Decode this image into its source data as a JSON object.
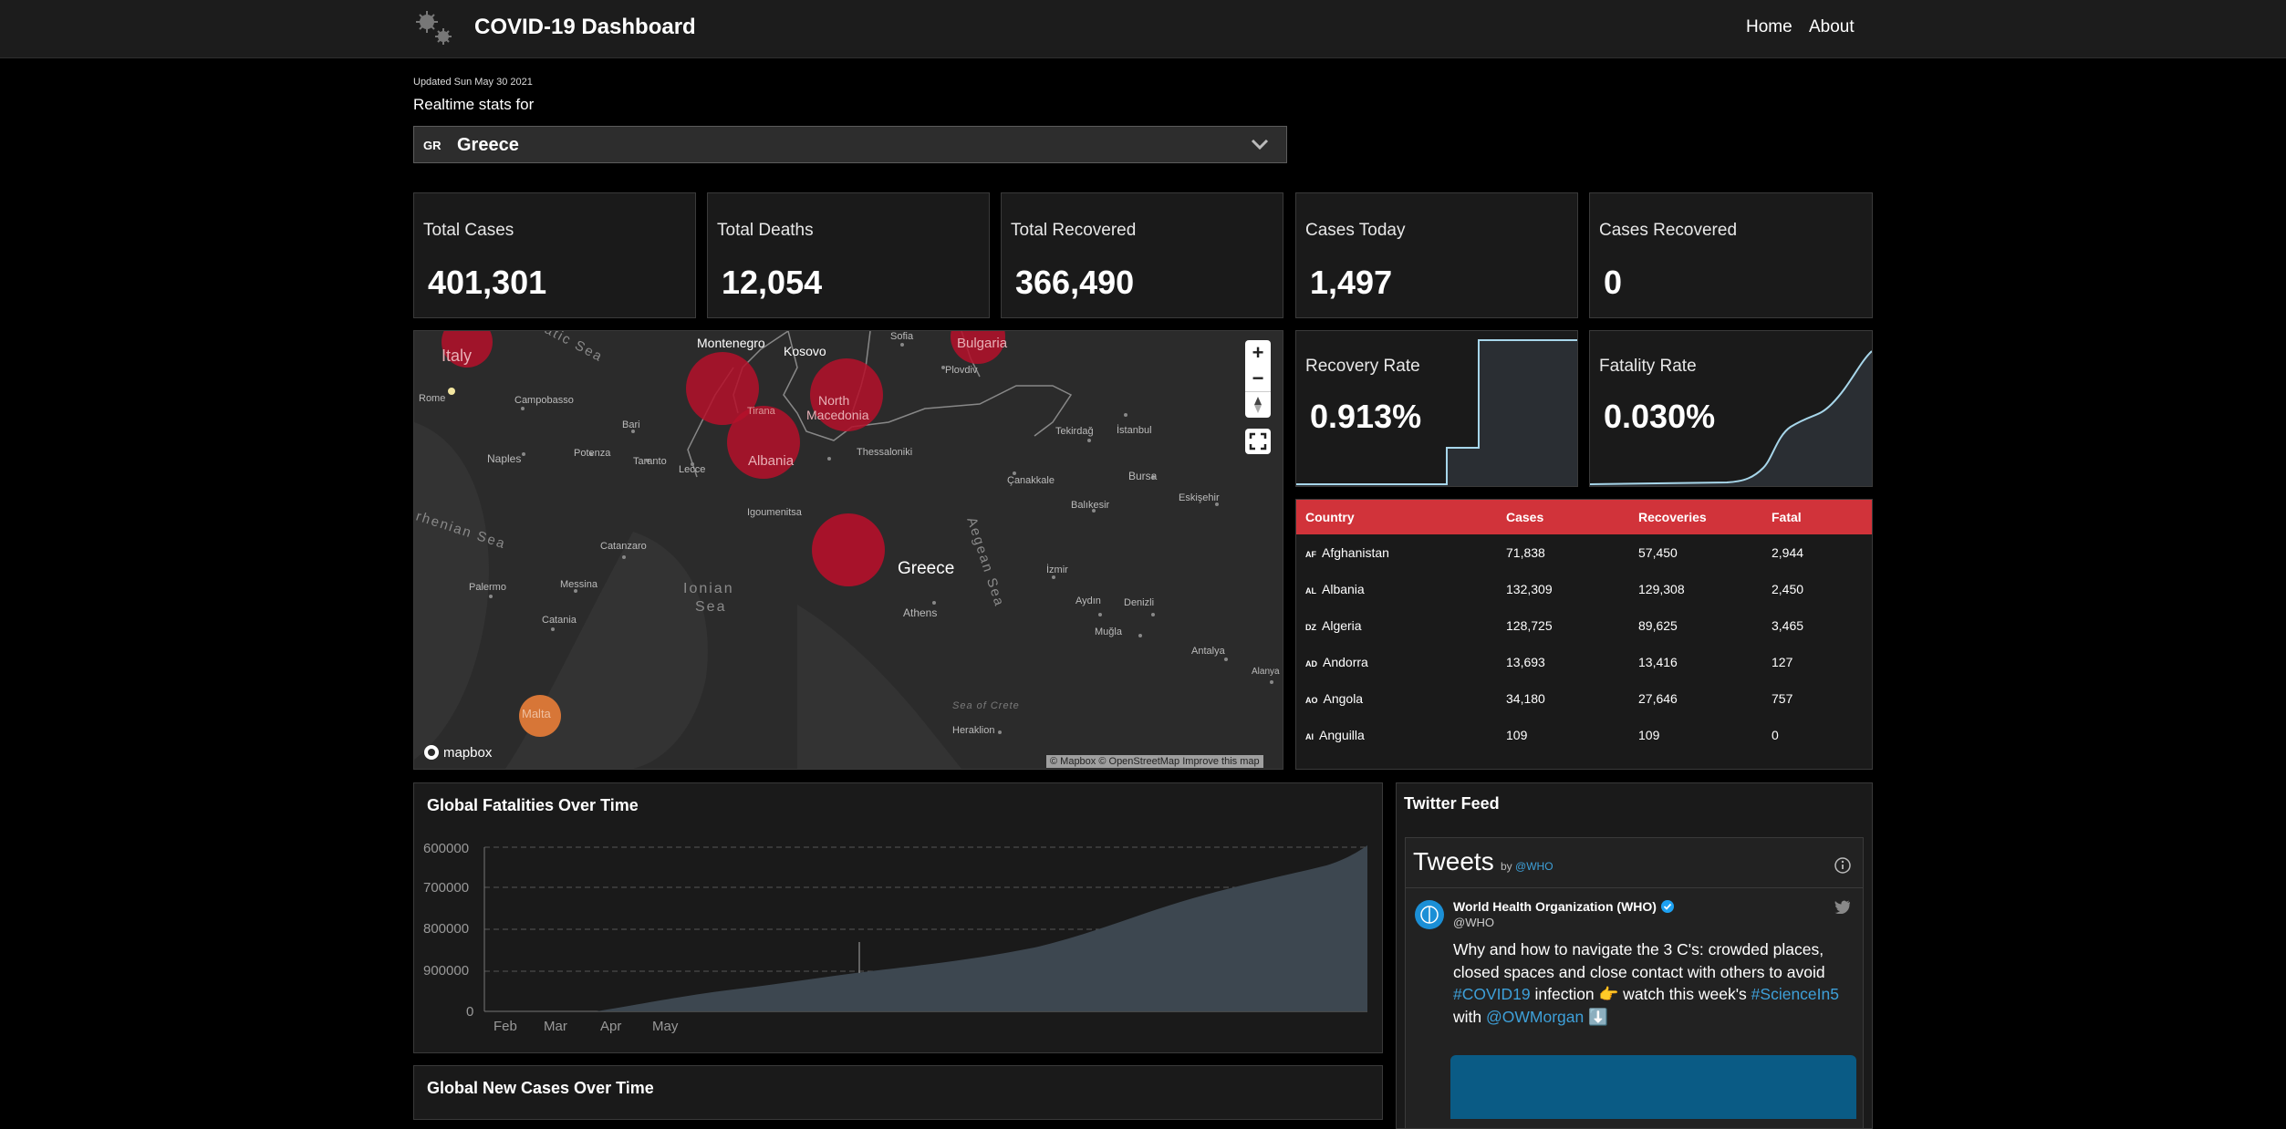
{
  "header": {
    "title": "COVID-19 Dashboard",
    "nav": {
      "home": "Home",
      "about": "About"
    }
  },
  "updated": "Updated Sun May 30 2021",
  "realtime_label": "Realtime stats for",
  "country_select": {
    "code": "GR",
    "value": "Greece"
  },
  "stats": {
    "total_cases": {
      "label": "Total Cases",
      "value": "401,301"
    },
    "total_deaths": {
      "label": "Total Deaths",
      "value": "12,054"
    },
    "total_recovered": {
      "label": "Total Recovered",
      "value": "366,490"
    },
    "cases_today": {
      "label": "Cases Today",
      "value": "1,497"
    },
    "cases_recovered": {
      "label": "Cases Recovered",
      "value": "0"
    },
    "recovery_rate": {
      "label": "Recovery Rate",
      "value": "0.913%"
    },
    "fatality_rate": {
      "label": "Fatality Rate",
      "value": "0.030%"
    }
  },
  "map": {
    "labels": {
      "italy": "Italy",
      "montenegro": "Montenegro",
      "kosovo": "Kosovo",
      "sofia": "Sofia",
      "bulgaria": "Bulgaria",
      "rome": "Rome",
      "campobasso": "Campobasso",
      "bari": "Bari",
      "north_macedonia_1": "North",
      "north_macedonia_2": "Macedonia",
      "tirana": "Tirana",
      "plovdiv": "Plovdiv",
      "tekirdag": "Tekirdağ",
      "istanbul": "İstanbul",
      "naples": "Naples",
      "potenza": "Potenza",
      "taranto": "Taranto",
      "lecce": "Lecce",
      "albania": "Albania",
      "thessaloniki": "Thessaloniki",
      "canakkale": "Çanakkale",
      "bursa": "Bursa",
      "eskisehir": "Eskişehir",
      "balikesir": "Balıkesir",
      "igoumenitsa": "Igoumenitsa",
      "tyrrhenian": "rhenian Sea",
      "adriatic": "atic Sea",
      "catanzaro": "Catanzaro",
      "greece": "Greece",
      "aegean": "Aegean Sea",
      "izmir": "İzmir",
      "palermo": "Palermo",
      "messina": "Messina",
      "ionian_1": "Ionian",
      "ionian_2": "Sea",
      "athens": "Athens",
      "aydin": "Aydın",
      "denizli": "Denizli",
      "catania": "Catania",
      "mugla": "Muğla",
      "antalya": "Antalya",
      "alanya": "Alanya",
      "malta": "Malta",
      "sea_of_crete": "Sea of Crete",
      "heraklion": "Heraklion"
    },
    "attribution": "© Mapbox © OpenStreetMap Improve this map",
    "brand": "mapbox",
    "controls": {
      "zoom_in": "+",
      "zoom_out": "−"
    }
  },
  "table": {
    "headers": [
      "Country",
      "Cases",
      "Recoveries",
      "Fatal"
    ],
    "rows": [
      {
        "code": "AF",
        "country": "Afghanistan",
        "cases": "71,838",
        "recoveries": "57,450",
        "fatal": "2,944"
      },
      {
        "code": "AL",
        "country": "Albania",
        "cases": "132,309",
        "recoveries": "129,308",
        "fatal": "2,450"
      },
      {
        "code": "DZ",
        "country": "Algeria",
        "cases": "128,725",
        "recoveries": "89,625",
        "fatal": "3,465"
      },
      {
        "code": "AD",
        "country": "Andorra",
        "cases": "13,693",
        "recoveries": "13,416",
        "fatal": "127"
      },
      {
        "code": "AO",
        "country": "Angola",
        "cases": "34,180",
        "recoveries": "27,646",
        "fatal": "757"
      },
      {
        "code": "AI",
        "country": "Anguilla",
        "cases": "109",
        "recoveries": "109",
        "fatal": "0"
      }
    ]
  },
  "fatalities_chart": {
    "title": "Global Fatalities Over Time",
    "y_ticks": [
      "600000",
      "700000",
      "800000",
      "900000",
      "0"
    ],
    "x_ticks": [
      "Feb",
      "Mar",
      "Apr",
      "May"
    ]
  },
  "new_cases_chart": {
    "title": "Global New Cases Over Time"
  },
  "twitter": {
    "panel_title": "Twitter Feed",
    "tweets_label": "Tweets",
    "by": "by",
    "handle_link": "@WHO",
    "author": "World Health Organization (WHO)",
    "author_handle": "@WHO",
    "text_1": "Why and how to navigate the 3 C's: crowded places,",
    "text_2": "closed spaces and close contact with others to avoid",
    "hashtag_1": "#COVID19",
    "text_3": " infection 👉 watch this week's ",
    "hashtag_2": "#ScienceIn5",
    "text_4": "with ",
    "mention": "@OWMorgan",
    "emoji": " ⬇️"
  },
  "colors": {
    "accent_red": "#d1333a",
    "bubble_red": "#b5102a",
    "bubble_orange": "#e07a38",
    "link_blue": "#3ea0d9"
  }
}
